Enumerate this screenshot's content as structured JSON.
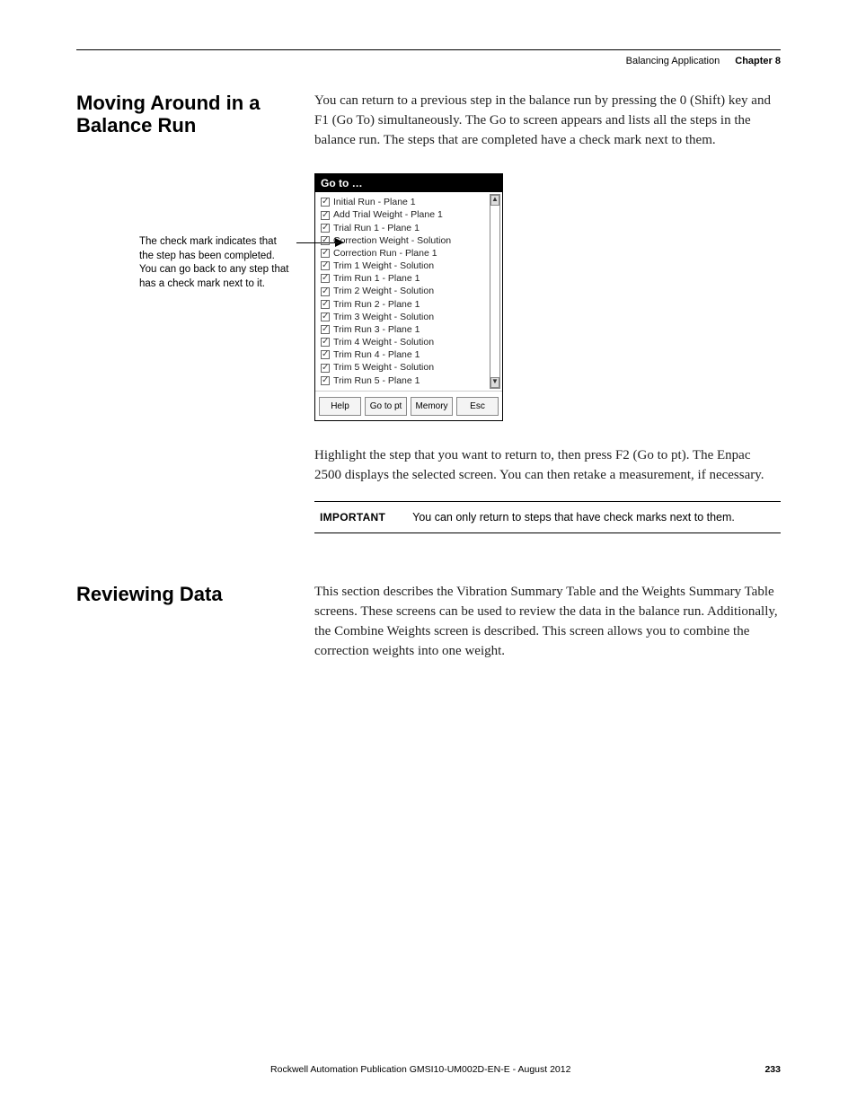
{
  "header": {
    "doc_title": "Balancing Application",
    "chapter_label": "Chapter 8"
  },
  "section1": {
    "heading": "Moving Around in a Balance Run",
    "para1": "You can return to a previous step in the balance run by pressing the 0 (Shift) key and F1 (Go To) simultaneously. The Go to screen appears and lists all the steps in the balance run. The steps that are completed have a check mark next to them.",
    "callout": "The check mark indicates that the step has been completed. You can go back to any step that has a check mark next to it.",
    "para2": "Highlight the step that you want to return to, then press F2 (Go to pt). The Enpac 2500 displays the selected screen. You can then retake a measurement, if necessary.",
    "important_label": "IMPORTANT",
    "important_text": "You can only return to steps that have check marks next to them."
  },
  "device": {
    "title": "Go to …",
    "steps": [
      "Initial Run - Plane 1",
      "Add Trial Weight - Plane 1",
      "Trial Run 1 - Plane 1",
      "Correction Weight - Solution",
      "Correction Run - Plane 1",
      "Trim 1 Weight - Solution",
      "Trim Run 1 - Plane 1",
      "Trim 2 Weight - Solution",
      "Trim Run 2 - Plane 1",
      "Trim 3 Weight - Solution",
      "Trim Run 3 - Plane 1",
      "Trim 4 Weight - Solution",
      "Trim Run 4 - Plane 1",
      "Trim 5 Weight - Solution",
      "Trim Run 5 - Plane 1"
    ],
    "buttons": {
      "help": "Help",
      "goto": "Go to pt",
      "memory": "Memory",
      "esc": "Esc"
    }
  },
  "section2": {
    "heading": "Reviewing Data",
    "para1": "This section describes the Vibration Summary Table and the Weights Summary Table screens. These screens can be used to review the data in the balance run. Additionally, the Combine Weights screen is described. This screen allows you to combine the correction weights into one weight."
  },
  "footer": {
    "publication": "Rockwell Automation Publication GMSI10-UM002D-EN-E - August 2012",
    "page": "233"
  }
}
